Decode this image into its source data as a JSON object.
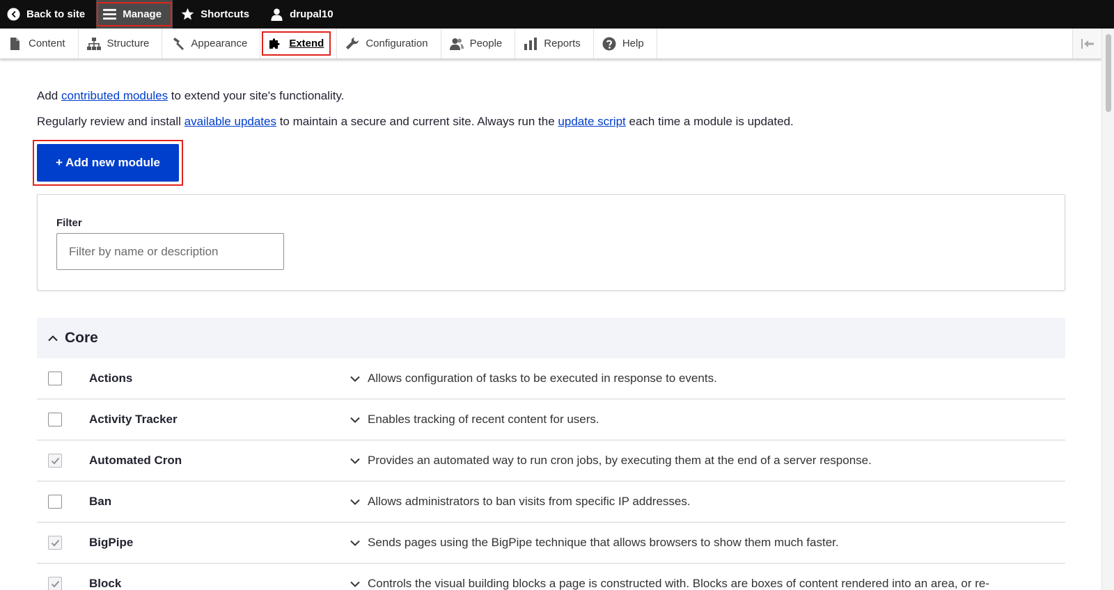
{
  "toolbar": {
    "back": "Back to site",
    "manage": "Manage",
    "shortcuts": "Shortcuts",
    "user": "drupal10"
  },
  "tray": {
    "items": [
      {
        "label": "Content",
        "icon": "file-icon"
      },
      {
        "label": "Structure",
        "icon": "sitemap-icon"
      },
      {
        "label": "Appearance",
        "icon": "hammer-icon"
      },
      {
        "label": "Extend",
        "icon": "puzzle-icon"
      },
      {
        "label": "Configuration",
        "icon": "wrench-icon"
      },
      {
        "label": "People",
        "icon": "people-icon"
      },
      {
        "label": "Reports",
        "icon": "bar-chart-icon"
      },
      {
        "label": "Help",
        "icon": "help-icon"
      }
    ]
  },
  "intro": {
    "p1_before": "Add ",
    "p1_link": "contributed modules",
    "p1_after": " to extend your site's functionality.",
    "p2_before": "Regularly review and install ",
    "p2_link1": "available updates",
    "p2_mid": " to maintain a secure and current site. Always run the ",
    "p2_link2": "update script",
    "p2_after": " each time a module is updated."
  },
  "add_button": "+ Add new module",
  "filter": {
    "label": "Filter",
    "placeholder": "Filter by name or description"
  },
  "core": {
    "title": "Core",
    "modules": [
      {
        "name": "Actions",
        "checked": false,
        "desc": "Allows configuration of tasks to be executed in response to events."
      },
      {
        "name": "Activity Tracker",
        "checked": false,
        "desc": "Enables tracking of recent content for users."
      },
      {
        "name": "Automated Cron",
        "checked": true,
        "desc": "Provides an automated way to run cron jobs, by executing them at the end of a server response."
      },
      {
        "name": "Ban",
        "checked": false,
        "desc": "Allows administrators to ban visits from specific IP addresses."
      },
      {
        "name": "BigPipe",
        "checked": true,
        "desc": "Sends pages using the BigPipe technique that allows browsers to show them much faster."
      },
      {
        "name": "Block",
        "checked": true,
        "desc": "Controls the visual building blocks a page is constructed with. Blocks are boxes of content rendered into an area, or re-"
      }
    ]
  },
  "colors": {
    "primary": "#003ecc",
    "highlight": "#e0231c",
    "toolbar": "#0f0f0f"
  }
}
